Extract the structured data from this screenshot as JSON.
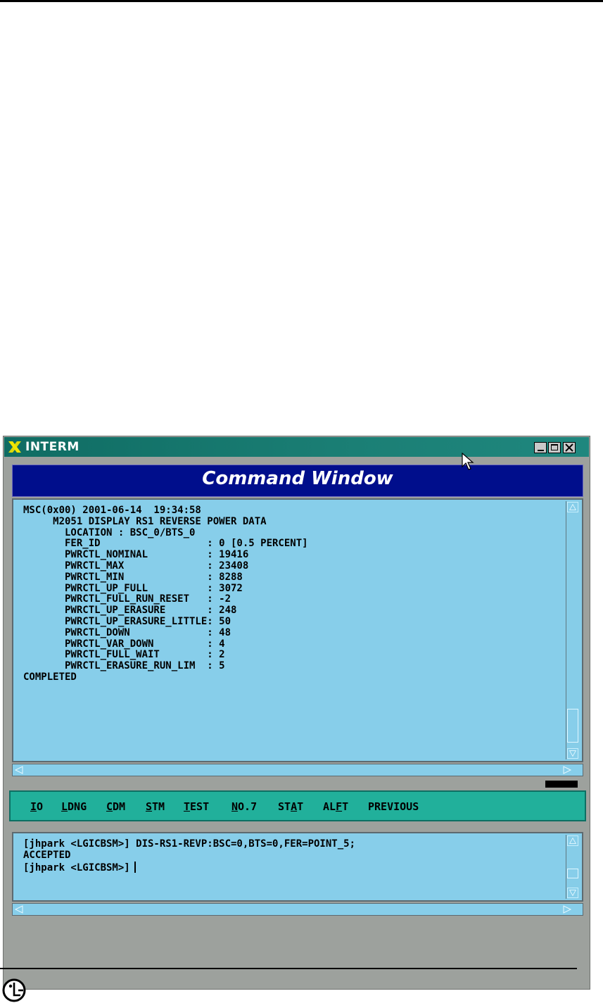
{
  "window": {
    "title": "INTERM",
    "header": "Command Window",
    "controls": [
      "minimize",
      "maximize",
      "close"
    ]
  },
  "output": {
    "lines": [
      "MSC(0x00) 2001-06-14  19:34:58",
      "     M2051 DISPLAY RS1 REVERSE POWER DATA",
      "       LOCATION : BSC_0/BTS_0",
      "       FER_ID                  : 0 [0.5 PERCENT]",
      "       PWRCTL_NOMINAL          : 19416",
      "       PWRCTL_MAX              : 23408",
      "       PWRCTL_MIN              : 8288",
      "       PWRCTL_UP_FULL          : 3072",
      "       PWRCTL_FULL_RUN_RESET   : -2",
      "       PWRCTL_UP_ERASURE       : 248",
      "       PWRCTL_UP_ERASURE_LITTLE: 50",
      "       PWRCTL_DOWN             : 48",
      "       PWRCTL_VAR_DOWN         : 4",
      "       PWRCTL_FULL_WAIT        : 2",
      "       PWRCTL_ERASURE_RUN_LIM  : 5",
      "COMPLETED"
    ]
  },
  "menu": {
    "items": [
      {
        "pre": "",
        "u": "I",
        "post": "O"
      },
      {
        "pre": "",
        "u": "L",
        "post": "DNG"
      },
      {
        "pre": "",
        "u": "C",
        "post": "DM"
      },
      {
        "pre": "",
        "u": "S",
        "post": "TM"
      },
      {
        "pre": "",
        "u": "T",
        "post": "EST"
      },
      {
        "pre": "",
        "u": "N",
        "post": "O.7"
      },
      {
        "pre": "ST",
        "u": "A",
        "post": "T"
      },
      {
        "pre": "AL",
        "u": "F",
        "post": "T"
      },
      {
        "pre": "PREVIOUS",
        "u": "",
        "post": ""
      }
    ]
  },
  "input": {
    "lines": [
      "[jhpark <LGICBSM>] DIS-RS1-REVP:BSC=0,BTS=0,FER=POINT_5;",
      "ACCEPTED",
      "[jhpark <LGICBSM>]"
    ]
  },
  "colors": {
    "terminal_bg": "#87ceea",
    "header_bg": "#000e8c",
    "menu_bg": "#21b09b",
    "titlebar": "#1b7f75"
  }
}
